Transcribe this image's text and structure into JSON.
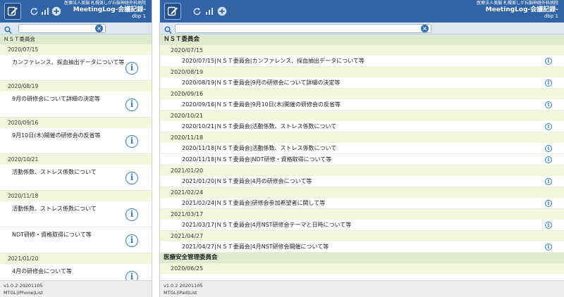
{
  "header": {
    "org": "医療法人美脳 札幌美しが丘脳神経外科病院",
    "app_title": "MeetingLog-会議記録-",
    "db": "dbp 1"
  },
  "icons": {
    "logo": "logo-pencil-icon",
    "refresh": "refresh-icon",
    "stats": "bar-chart-icon",
    "add": "add-icon",
    "search": "search-icon",
    "clear": "clear-search-icon",
    "info": "info-icon"
  },
  "iphone": {
    "search": {
      "value": "",
      "placeholder": ""
    },
    "groups": [
      {
        "title": "ＮＳＴ委員会",
        "dates": [
          {
            "date": "2020/07/15",
            "items": [
              "カンファレンス、採血抽出データについて等"
            ]
          },
          {
            "date": "2020/08/19",
            "items": [
              "9月の研修会について詳細の決定等"
            ]
          },
          {
            "date": "2020/09/16",
            "items": [
              "9月10日(木)開催の研修会の反省等"
            ]
          },
          {
            "date": "2020/10/21",
            "items": [
              "活動係数、ストレス係数について"
            ]
          },
          {
            "date": "2020/11/18",
            "items": [
              "活動係数、ストレス係数について",
              "NDT研修・資格取得について等"
            ]
          },
          {
            "date": "2021/01/20",
            "items": [
              "4月の研修会について等"
            ]
          }
        ]
      }
    ],
    "footer": {
      "version": "v1.0.2 20201105",
      "mode": "MTGL|iPhone|List"
    }
  },
  "ipad": {
    "search": {
      "value": "",
      "placeholder": ""
    },
    "groups": [
      {
        "title": "ＮＳＴ委員会",
        "dates": [
          {
            "date": "2020/07/15",
            "items": [
              "2020/07/15|ＮＳＴ委員会|カンファレンス、採血抽出データについて等"
            ]
          },
          {
            "date": "2020/08/19",
            "items": [
              "2020/08/19|ＮＳＴ委員会|9月の研修会について詳細の決定等"
            ]
          },
          {
            "date": "2020/09/16",
            "items": [
              "2020/09/16|ＮＳＴ委員会|9月10日(木)開催の研修会の反省等"
            ]
          },
          {
            "date": "2020/10/21",
            "items": [
              "2020/10/21|ＮＳＴ委員会|活動係数、ストレス係数について"
            ]
          },
          {
            "date": "2020/11/18",
            "items": [
              "2020/11/18|ＮＳＴ委員会|活動係数、ストレス係数について",
              "2020/11/18|ＮＳＴ委員会|NDT研修・資格取得について等"
            ]
          },
          {
            "date": "2021/01/20",
            "items": [
              "2021/01/20|ＮＳＴ委員会|4月の研修会について等"
            ]
          },
          {
            "date": "2021/02/24",
            "items": [
              "2021/02/24|ＮＳＴ委員会|研修会参加希望者に関して等"
            ]
          },
          {
            "date": "2021/03/17",
            "items": [
              "2021/03/17|ＮＳＴ委員会|4月NST研修会テーマと日時について等"
            ]
          },
          {
            "date": "2021/04/27",
            "items": [
              "2021/04/27|ＮＳＴ委員会|4月NST研修会開催について等"
            ]
          }
        ]
      },
      {
        "title": "医療安全管理委員会",
        "dates": [
          {
            "date": "2020/06/25",
            "items": []
          }
        ]
      }
    ],
    "footer": {
      "version": "v1.0.2 20201105",
      "mode": "MTGL|iPad|List"
    }
  }
}
